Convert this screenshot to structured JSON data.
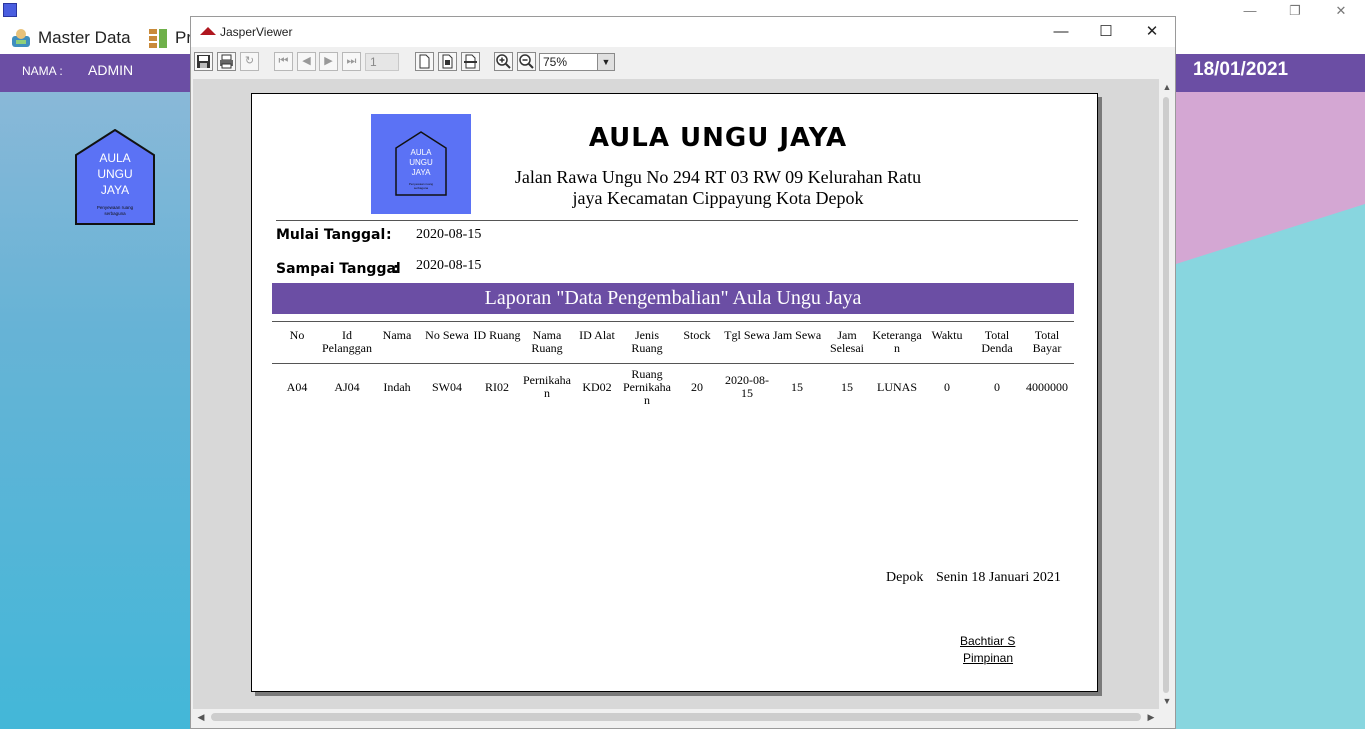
{
  "main_app": {
    "menu": {
      "master_data": "Master Data",
      "second_item": "Pr"
    },
    "user": {
      "nama_label": "NAMA  :",
      "nama_value": "ADMIN"
    },
    "date": "18/01/2021",
    "logo": {
      "line1": "AULA",
      "line2": "UNGU",
      "line3": "JAYA",
      "tagline1": "Penyewaan ruang",
      "tagline2": "serbaguna"
    },
    "window_controls": {
      "minimize": "—",
      "restore": "❐",
      "close": "✕"
    }
  },
  "viewer": {
    "title": "JasperViewer",
    "window_controls": {
      "minimize": "—",
      "maximize": "☐",
      "close": "✕"
    },
    "toolbar": {
      "page_number": "1",
      "zoom": "75%",
      "icons": [
        "save-icon",
        "print-icon",
        "reload-icon",
        "first-page-icon",
        "previous-page-icon",
        "next-page-icon",
        "last-page-icon",
        "actual-size-icon",
        "fit-page-icon",
        "fit-width-icon",
        "zoom-in-icon",
        "zoom-out-icon"
      ]
    }
  },
  "report": {
    "company_name": "AULA UNGU JAYA",
    "address_line1": "Jalan Rawa Ungu No 294 RT 03 RW 09 Kelurahan Ratu",
    "address_line2": "jaya Kecamatan Cippayung Kota Depok",
    "logo": {
      "line1": "AULA",
      "line2": "UNGU",
      "line3": "JAYA",
      "tagline1": "Penyewaan ruang",
      "tagline2": "serbaguna"
    },
    "filters": {
      "start_label": "Mulai Tanggal",
      "start_value": "2020-08-15",
      "end_label": "Sampai Tanggal",
      "end_value": "2020-08-15",
      "colon": ":"
    },
    "banner": "Laporan \"Data Pengembalian\" Aula Ungu Jaya",
    "columns": [
      [
        "No"
      ],
      [
        "Id",
        "Pelanggan"
      ],
      [
        "Nama"
      ],
      [
        "No Sewa"
      ],
      [
        "ID Ruang"
      ],
      [
        "Nama",
        "Ruang"
      ],
      [
        "ID Alat"
      ],
      [
        "Jenis",
        "Ruang"
      ],
      [
        "Stock"
      ],
      [
        "Tgl Sewa"
      ],
      [
        "Jam Sewa"
      ],
      [
        "Jam",
        "Selesai"
      ],
      [
        "Keteranga",
        "n"
      ],
      [
        "Waktu"
      ],
      [
        "Total",
        "Denda"
      ],
      [
        "Total",
        "Bayar"
      ]
    ],
    "rows": [
      [
        [
          "A04"
        ],
        [
          "AJ04"
        ],
        [
          "Indah"
        ],
        [
          "SW04"
        ],
        [
          "RI02"
        ],
        [
          "Pernikaha",
          "n"
        ],
        [
          "KD02"
        ],
        [
          "Ruang",
          "Pernikaha",
          "n"
        ],
        [
          "20"
        ],
        [
          "2020-08-",
          "15"
        ],
        [
          "15"
        ],
        [
          "15"
        ],
        [
          "LUNAS"
        ],
        [
          "0"
        ],
        [
          "0"
        ],
        [
          "4000000"
        ]
      ]
    ],
    "signature": {
      "place": "Depok",
      "date": "Senin 18 Januari 2021",
      "name": "Bachtiar S",
      "title": "Pimpinan"
    }
  }
}
